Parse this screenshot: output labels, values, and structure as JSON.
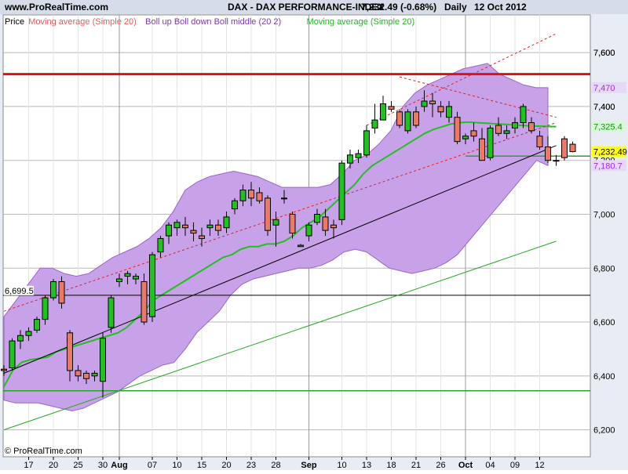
{
  "header": {
    "site": "www.ProRealTime.com",
    "title": "DAX - DAX PERFORMANCE-INDEX",
    "last": "7,232.49 (-0.68%)",
    "period": "Daily",
    "date": "12 Oct 2012"
  },
  "legend": [
    {
      "label": "Price",
      "color": "#000000"
    },
    {
      "label": "Moving average (Simple 20)",
      "color": "#e85a5a"
    },
    {
      "label": "Boll up Boll down Boll middle (20 2)",
      "color": "#7a3aa8"
    },
    {
      "label": "Moving average (Simple 20)",
      "color": "#22b822"
    }
  ],
  "footer": {
    "copyright": "© ProRealTime.com"
  },
  "colors": {
    "bull": "#22c022",
    "bear": "#e87a6a",
    "band_fill": "#c8a2e8",
    "band_stroke": "#9a66c8",
    "ma": "#22c022",
    "resistance": "#e01010",
    "support": "#22a822",
    "grid": "#b8b8b8",
    "plot_bg": "#ffffff",
    "frame_bg": "#e8ecf4"
  },
  "chart_data": {
    "type": "candlestick",
    "title": "DAX - DAX PERFORMANCE-INDEX",
    "ylim": [
      6100,
      7740
    ],
    "y_ticks": [
      6200,
      6400,
      6600,
      6800,
      7000,
      7200,
      7400,
      7600
    ],
    "y_tick_labels": [
      "6,200",
      "6,400",
      "6,600",
      "6,800",
      "7,000",
      "7,200",
      "7,400",
      "7,600"
    ],
    "x_ticks": [
      {
        "i": 3,
        "label": "17"
      },
      {
        "i": 6,
        "label": "20"
      },
      {
        "i": 9,
        "label": "25"
      },
      {
        "i": 12,
        "label": "30"
      },
      {
        "i": 14,
        "label": "Aug"
      },
      {
        "i": 18,
        "label": "07"
      },
      {
        "i": 21,
        "label": "10"
      },
      {
        "i": 24,
        "label": "15"
      },
      {
        "i": 27,
        "label": "20"
      },
      {
        "i": 30,
        "label": "23"
      },
      {
        "i": 33,
        "label": "28"
      },
      {
        "i": 37,
        "label": "Sep"
      },
      {
        "i": 41,
        "label": "10"
      },
      {
        "i": 44,
        "label": "13"
      },
      {
        "i": 47,
        "label": "18"
      },
      {
        "i": 50,
        "label": "21"
      },
      {
        "i": 53,
        "label": "26"
      },
      {
        "i": 56,
        "label": "Oct"
      },
      {
        "i": 59,
        "label": "04"
      },
      {
        "i": 62,
        "label": "09"
      },
      {
        "i": 65,
        "label": "12"
      }
    ],
    "month_separators": [
      14,
      37,
      56
    ],
    "candles": [
      [
        6425,
        6440,
        6400,
        6420
      ],
      [
        6430,
        6540,
        6420,
        6530
      ],
      [
        6530,
        6570,
        6500,
        6550
      ],
      [
        6550,
        6580,
        6530,
        6565
      ],
      [
        6570,
        6620,
        6560,
        6610
      ],
      [
        6610,
        6700,
        6590,
        6690
      ],
      [
        6690,
        6760,
        6680,
        6750
      ],
      [
        6750,
        6770,
        6650,
        6670
      ],
      [
        6560,
        6570,
        6380,
        6420
      ],
      [
        6420,
        6440,
        6380,
        6400
      ],
      [
        6410,
        6420,
        6370,
        6390
      ],
      [
        6400,
        6420,
        6380,
        6410
      ],
      [
        6380,
        6560,
        6320,
        6540
      ],
      [
        6580,
        6700,
        6560,
        6690
      ],
      [
        6750,
        6780,
        6730,
        6760
      ],
      [
        6770,
        6790,
        6740,
        6780
      ],
      [
        6760,
        6780,
        6740,
        6770
      ],
      [
        6750,
        6780,
        6590,
        6600
      ],
      [
        6620,
        6860,
        6600,
        6850
      ],
      [
        6860,
        6920,
        6840,
        6910
      ],
      [
        6920,
        6970,
        6890,
        6960
      ],
      [
        6950,
        6980,
        6920,
        6970
      ],
      [
        6960,
        6990,
        6920,
        6950
      ],
      [
        6940,
        6970,
        6900,
        6930
      ],
      [
        6920,
        6950,
        6880,
        6910
      ],
      [
        6950,
        6980,
        6920,
        6960
      ],
      [
        6960,
        6980,
        6920,
        6940
      ],
      [
        6950,
        7010,
        6930,
        6990
      ],
      [
        7020,
        7060,
        7000,
        7050
      ],
      [
        7050,
        7110,
        7030,
        7090
      ],
      [
        7090,
        7120,
        7030,
        7060
      ],
      [
        7080,
        7100,
        7040,
        7050
      ],
      [
        7060,
        7070,
        6920,
        6940
      ],
      [
        6960,
        7010,
        6880,
        6980
      ],
      [
        7060,
        7090,
        7040,
        7060
      ],
      [
        7000,
        7010,
        6910,
        6930
      ],
      [
        6880,
        6890,
        6880,
        6885
      ],
      [
        6920,
        6970,
        6900,
        6960
      ],
      [
        6970,
        7020,
        6960,
        7000
      ],
      [
        6990,
        7020,
        6920,
        6940
      ],
      [
        6960,
        6980,
        6910,
        6950
      ],
      [
        6980,
        7200,
        6960,
        7190
      ],
      [
        7190,
        7240,
        7170,
        7220
      ],
      [
        7210,
        7240,
        7190,
        7225
      ],
      [
        7220,
        7330,
        7210,
        7310
      ],
      [
        7320,
        7410,
        7300,
        7350
      ],
      [
        7350,
        7440,
        7360,
        7410
      ],
      [
        7400,
        7420,
        7380,
        7390
      ],
      [
        7380,
        7390,
        7320,
        7330
      ],
      [
        7310,
        7390,
        7300,
        7380
      ],
      [
        7380,
        7400,
        7320,
        7330
      ],
      [
        7400,
        7460,
        7380,
        7420
      ],
      [
        7420,
        7450,
        7360,
        7410
      ],
      [
        7400,
        7420,
        7360,
        7380
      ],
      [
        7360,
        7420,
        7340,
        7400
      ],
      [
        7360,
        7380,
        7260,
        7270
      ],
      [
        7280,
        7300,
        7260,
        7290
      ],
      [
        7310,
        7340,
        7270,
        7290
      ],
      [
        7280,
        7320,
        7200,
        7200
      ],
      [
        7210,
        7330,
        7200,
        7320
      ],
      [
        7330,
        7360,
        7290,
        7300
      ],
      [
        7300,
        7330,
        7280,
        7310
      ],
      [
        7320,
        7360,
        7300,
        7340
      ],
      [
        7340,
        7410,
        7320,
        7400
      ],
      [
        7340,
        7360,
        7300,
        7310
      ],
      [
        7290,
        7310,
        7240,
        7250
      ],
      [
        7250,
        7290,
        7190,
        7200
      ],
      [
        7200,
        7220,
        7180,
        7200
      ],
      [
        7280,
        7290,
        7200,
        7210
      ],
      [
        7260,
        7270,
        7230,
        7232.49
      ]
    ],
    "ma20": [
      6360,
      6420,
      6450,
      6460,
      6465,
      6470,
      6490,
      6500,
      6510,
      6520,
      6530,
      6540,
      6550,
      6560,
      6580,
      6610,
      6640,
      6680,
      6700,
      6720,
      6740,
      6760,
      6780,
      6800,
      6820,
      6840,
      6850,
      6870,
      6880,
      6880,
      6890,
      6890,
      6900,
      6920,
      6950,
      6970,
      6990,
      7020,
      7050,
      7080,
      7110,
      7150,
      7180,
      7200,
      7220,
      7240,
      7260,
      7280,
      7300,
      7315,
      7325,
      7335,
      7340,
      7342,
      7340,
      7338,
      7336,
      7334,
      7332,
      7330,
      7328,
      7327,
      7326,
      7325.4
    ],
    "boll_up": [
      6620,
      6680,
      6740,
      6800,
      6800,
      6780,
      6770,
      6780,
      6810,
      6840,
      6860,
      6880,
      6910,
      6950,
      7010,
      7090,
      7120,
      7140,
      7150,
      7160,
      7150,
      7140,
      7120,
      7100,
      7100,
      7100,
      7100,
      7110,
      7150,
      7200,
      7220,
      7260,
      7310,
      7400,
      7450,
      7480,
      7500,
      7520,
      7540,
      7550,
      7560,
      7520,
      7500,
      7480,
      7470,
      7470
    ],
    "boll_down": [
      6310,
      6300,
      6300,
      6300,
      6290,
      6280,
      6270,
      6280,
      6300,
      6320,
      6340,
      6370,
      6400,
      6420,
      6440,
      6450,
      6500,
      6560,
      6600,
      6640,
      6700,
      6740,
      6760,
      6770,
      6780,
      6790,
      6800,
      6800,
      6810,
      6830,
      6860,
      6870,
      6860,
      6830,
      6800,
      6790,
      6780,
      6790,
      6800,
      6820,
      6850,
      6900,
      6950,
      7000,
      7050,
      7100,
      7150,
      7200,
      7180.7
    ],
    "horizontal_lines": [
      {
        "value": 7520,
        "color": "#e01010"
      },
      {
        "value": 6699.5,
        "color": "#000000"
      },
      {
        "value": 6345,
        "color": "#22a822"
      },
      {
        "value": 7216,
        "color": "#22a822"
      }
    ],
    "trend_lines": [
      {
        "from": [
          0,
          6410
        ],
        "to": [
          67,
          7255
        ],
        "color": "#000000"
      },
      {
        "from": [
          0,
          6200
        ],
        "to": [
          67,
          6900
        ],
        "color": "#22a822"
      },
      {
        "from": [
          0,
          6640
        ],
        "to": [
          67,
          7340
        ],
        "color": "#e02020",
        "dashed": true
      },
      {
        "from": [
          44,
          7330
        ],
        "to": [
          67,
          7670
        ],
        "color": "#e02020",
        "dashed": true
      },
      {
        "from": [
          48,
          7510
        ],
        "to": [
          67,
          7360
        ],
        "color": "#e02020",
        "dashed": true
      }
    ],
    "price_labels": [
      {
        "value": 7600,
        "label": "7,600",
        "fill": "none"
      },
      {
        "value": 7470,
        "label": "7,470",
        "fill": "#e8d8f8"
      },
      {
        "value": 7400,
        "label": "7,400",
        "fill": "none"
      },
      {
        "value": 7325.4,
        "label": "7,325.4",
        "fill": "#d8f8d8"
      },
      {
        "value": 7232.49,
        "label": "7,232.49",
        "fill": "#ffff20"
      },
      {
        "value": 7180.7,
        "label": "7,180.7",
        "fill": "#e8d8f8"
      },
      {
        "value": 6699.5,
        "label": "6,699.5",
        "fill": "#ffffff"
      }
    ]
  }
}
